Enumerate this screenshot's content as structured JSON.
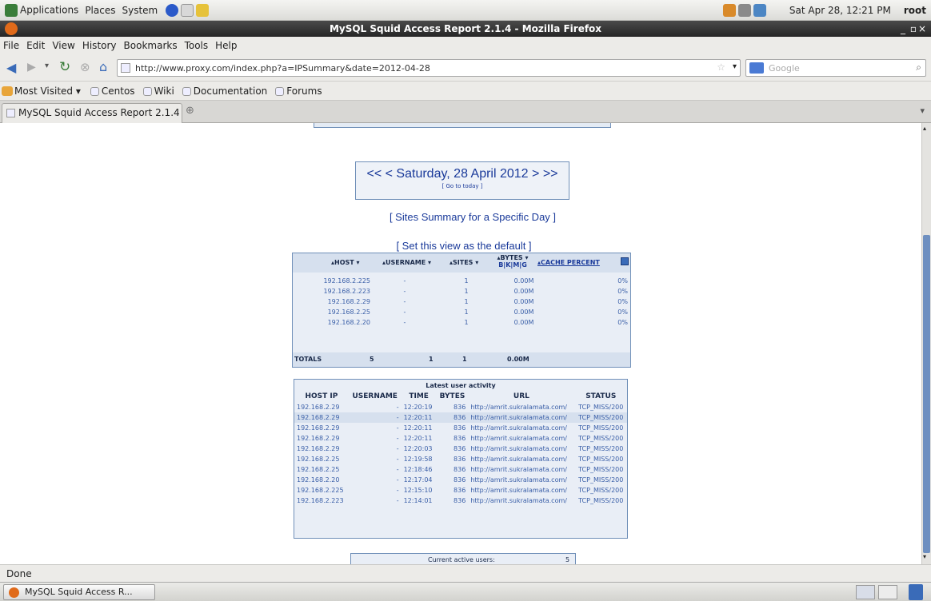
{
  "panel": {
    "menus": [
      "Applications",
      "Places",
      "System"
    ],
    "datetime": "Sat Apr 28, 12:21 PM",
    "user": "root"
  },
  "window": {
    "title": "MySQL Squid Access Report 2.1.4 - Mozilla Firefox"
  },
  "menubar": [
    "File",
    "Edit",
    "View",
    "History",
    "Bookmarks",
    "Tools",
    "Help"
  ],
  "navbar": {
    "url": "http://www.proxy.com/index.php?a=IPSummary&date=2012-04-28",
    "search_placeholder": "Google"
  },
  "bookmarks": [
    "Most Visited",
    "Centos",
    "Wiki",
    "Documentation",
    "Forums"
  ],
  "tab": {
    "label": "MySQL Squid Access Report 2.1.4"
  },
  "page": {
    "date_nav": {
      "first": "<<",
      "prev": "<",
      "date": "Saturday, 28 April 2012",
      "next": ">",
      "last": ">>",
      "today": "[ Go to today ]"
    },
    "sites_summary": "[ Sites Summary for a Specific Day ]",
    "set_default": "[ Set this view as the default ]",
    "hosts_table": {
      "headers": [
        "HOST",
        "USERNAME",
        "SITES",
        "BYTES",
        "CACHE PERCENT"
      ],
      "bytes_units": "B|K|M|G",
      "rows": [
        [
          "192.168.2.225",
          "-",
          "1",
          "0.00M",
          "0%"
        ],
        [
          "192.168.2.223",
          "-",
          "1",
          "0.00M",
          "0%"
        ],
        [
          "192.168.2.29",
          "-",
          "1",
          "0.00M",
          "0%"
        ],
        [
          "192.168.2.25",
          "-",
          "1",
          "0.00M",
          "0%"
        ],
        [
          "192.168.2.20",
          "-",
          "1",
          "0.00M",
          "0%"
        ]
      ],
      "totals": {
        "label": "TOTALS",
        "hosts": "5",
        "users": "1",
        "sites": "1",
        "bytes": "0.00M"
      }
    },
    "activity": {
      "title": "Latest user activity",
      "headers": [
        "HOST IP",
        "USERNAME",
        "TIME",
        "BYTES",
        "URL",
        "STATUS"
      ],
      "rows": [
        [
          "192.168.2.29",
          "-",
          "12:20:19",
          "836",
          "http://amrit.sukralamata.com/",
          "TCP_MISS/200"
        ],
        [
          "192.168.2.29",
          "-",
          "12:20:11",
          "836",
          "http://amrit.sukralamata.com/",
          "TCP_MISS/200"
        ],
        [
          "192.168.2.29",
          "-",
          "12:20:11",
          "836",
          "http://amrit.sukralamata.com/",
          "TCP_MISS/200"
        ],
        [
          "192.168.2.29",
          "-",
          "12:20:11",
          "836",
          "http://amrit.sukralamata.com/",
          "TCP_MISS/200"
        ],
        [
          "192.168.2.29",
          "-",
          "12:20:03",
          "836",
          "http://amrit.sukralamata.com/",
          "TCP_MISS/200"
        ],
        [
          "192.168.2.25",
          "-",
          "12:19:58",
          "836",
          "http://amrit.sukralamata.com/",
          "TCP_MISS/200"
        ],
        [
          "192.168.2.25",
          "-",
          "12:18:46",
          "836",
          "http://amrit.sukralamata.com/",
          "TCP_MISS/200"
        ],
        [
          "192.168.2.20",
          "-",
          "12:17:04",
          "836",
          "http://amrit.sukralamata.com/",
          "TCP_MISS/200"
        ],
        [
          "192.168.2.225",
          "-",
          "12:15:10",
          "836",
          "http://amrit.sukralamata.com/",
          "TCP_MISS/200"
        ],
        [
          "192.168.2.223",
          "-",
          "12:14:01",
          "836",
          "http://amrit.sukralamata.com/",
          "TCP_MISS/200"
        ]
      ]
    },
    "active_users": {
      "label": "Current active users:",
      "value": "5"
    }
  },
  "status": "Done",
  "taskbar": {
    "item": "MySQL Squid Access R..."
  }
}
